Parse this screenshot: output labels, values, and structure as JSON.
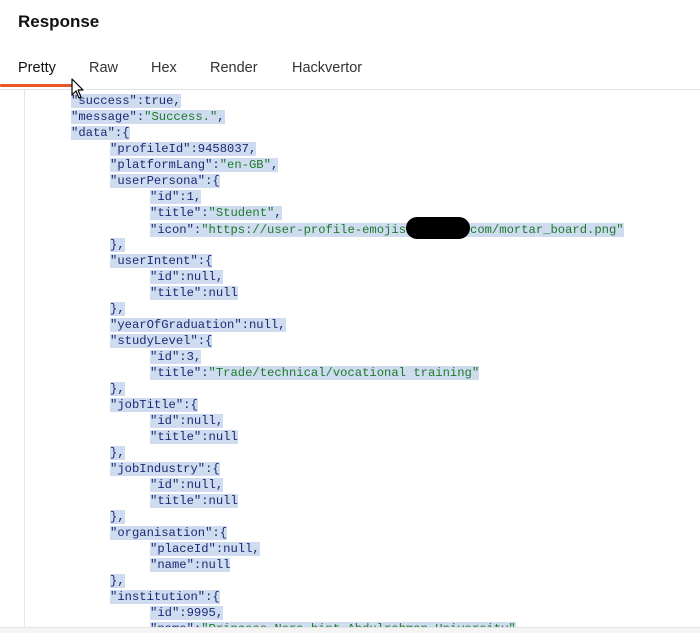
{
  "panel": {
    "title": "Response"
  },
  "tabs": [
    {
      "label": "Pretty",
      "active": true
    },
    {
      "label": "Raw",
      "active": false
    },
    {
      "label": "Hex",
      "active": false
    },
    {
      "label": "Render",
      "active": false
    },
    {
      "label": "Hackvertor",
      "active": false
    }
  ],
  "colors": {
    "accent": "#e8562a",
    "selection": "#cfdcf0",
    "key": "#1a2a72",
    "string": "#1e7a2a"
  },
  "icons": {
    "pointer": "mouse-pointer-icon"
  },
  "code_lines": [
    [
      [
        "k",
        "\"success\""
      ],
      [
        "p",
        ":"
      ],
      [
        "v",
        "true"
      ],
      [
        "p",
        ","
      ]
    ],
    [
      [
        "k",
        "\"message\""
      ],
      [
        "p",
        ":"
      ],
      [
        "s",
        "\"Success.\""
      ],
      [
        "p",
        ","
      ]
    ],
    [
      [
        "k",
        "\"data\""
      ],
      [
        "p",
        ":{"
      ]
    ],
    [
      [
        "k",
        "\"profileId\""
      ],
      [
        "p",
        ":"
      ],
      [
        "v",
        "9458037"
      ],
      [
        "p",
        ","
      ]
    ],
    [
      [
        "k",
        "\"platformLang\""
      ],
      [
        "p",
        ":"
      ],
      [
        "s",
        "\"en-GB\""
      ],
      [
        "p",
        ","
      ]
    ],
    [
      [
        "k",
        "\"userPersona\""
      ],
      [
        "p",
        ":{"
      ]
    ],
    [
      [
        "k",
        "\"id\""
      ],
      [
        "p",
        ":"
      ],
      [
        "v",
        "1"
      ],
      [
        "p",
        ","
      ]
    ],
    [
      [
        "k",
        "\"title\""
      ],
      [
        "p",
        ":"
      ],
      [
        "s",
        "\"Student\""
      ],
      [
        "p",
        ","
      ]
    ],
    [
      [
        "k",
        "\"icon\""
      ],
      [
        "p",
        ":"
      ],
      [
        "s",
        "\"https://user-profile-emojis"
      ],
      [
        "redact",
        ""
      ],
      [
        "s",
        "com/mortar_board.png\""
      ]
    ],
    [
      [
        "p",
        "},"
      ]
    ],
    [
      [
        "k",
        "\"userIntent\""
      ],
      [
        "p",
        ":{"
      ]
    ],
    [
      [
        "k",
        "\"id\""
      ],
      [
        "p",
        ":"
      ],
      [
        "v",
        "null"
      ],
      [
        "p",
        ","
      ]
    ],
    [
      [
        "k",
        "\"title\""
      ],
      [
        "p",
        ":"
      ],
      [
        "v",
        "null"
      ]
    ],
    [
      [
        "p",
        "},"
      ]
    ],
    [
      [
        "k",
        "\"yearOfGraduation\""
      ],
      [
        "p",
        ":"
      ],
      [
        "v",
        "null"
      ],
      [
        "p",
        ","
      ]
    ],
    [
      [
        "k",
        "\"studyLevel\""
      ],
      [
        "p",
        ":{"
      ]
    ],
    [
      [
        "k",
        "\"id\""
      ],
      [
        "p",
        ":"
      ],
      [
        "v",
        "3"
      ],
      [
        "p",
        ","
      ]
    ],
    [
      [
        "k",
        "\"title\""
      ],
      [
        "p",
        ":"
      ],
      [
        "s",
        "\"Trade/technical/vocational training\""
      ]
    ],
    [
      [
        "p",
        "},"
      ]
    ],
    [
      [
        "k",
        "\"jobTitle\""
      ],
      [
        "p",
        ":{"
      ]
    ],
    [
      [
        "k",
        "\"id\""
      ],
      [
        "p",
        ":"
      ],
      [
        "v",
        "null"
      ],
      [
        "p",
        ","
      ]
    ],
    [
      [
        "k",
        "\"title\""
      ],
      [
        "p",
        ":"
      ],
      [
        "v",
        "null"
      ]
    ],
    [
      [
        "p",
        "},"
      ]
    ],
    [
      [
        "k",
        "\"jobIndustry\""
      ],
      [
        "p",
        ":{"
      ]
    ],
    [
      [
        "k",
        "\"id\""
      ],
      [
        "p",
        ":"
      ],
      [
        "v",
        "null"
      ],
      [
        "p",
        ","
      ]
    ],
    [
      [
        "k",
        "\"title\""
      ],
      [
        "p",
        ":"
      ],
      [
        "v",
        "null"
      ]
    ],
    [
      [
        "p",
        "},"
      ]
    ],
    [
      [
        "k",
        "\"organisation\""
      ],
      [
        "p",
        ":{"
      ]
    ],
    [
      [
        "k",
        "\"placeId\""
      ],
      [
        "p",
        ":"
      ],
      [
        "v",
        "null"
      ],
      [
        "p",
        ","
      ]
    ],
    [
      [
        "k",
        "\"name\""
      ],
      [
        "p",
        ":"
      ],
      [
        "v",
        "null"
      ]
    ],
    [
      [
        "p",
        "},"
      ]
    ],
    [
      [
        "k",
        "\"institution\""
      ],
      [
        "p",
        ":{"
      ]
    ],
    [
      [
        "k",
        "\"id\""
      ],
      [
        "p",
        ":"
      ],
      [
        "v",
        "9995"
      ],
      [
        "p",
        ","
      ]
    ],
    [
      [
        "k",
        "\"name\""
      ],
      [
        "p",
        ":"
      ],
      [
        "s",
        "\"Princess Nora bint Abdulrahman University\""
      ]
    ]
  ]
}
